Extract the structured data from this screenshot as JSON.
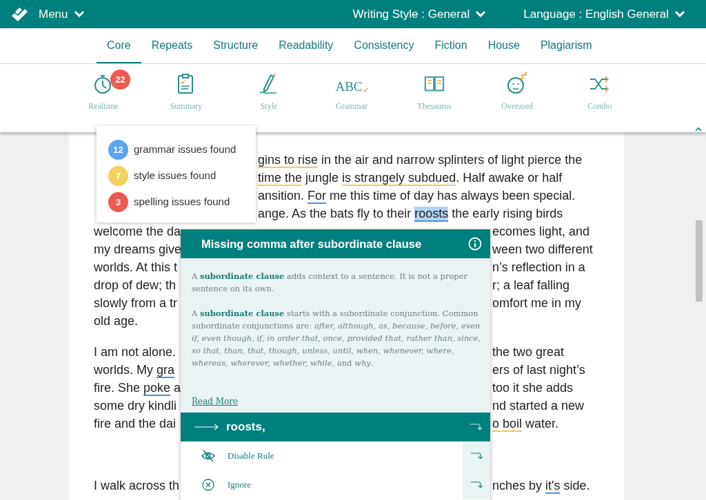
{
  "app_bar": {
    "menu_label": "Menu",
    "writing_style": "Writing Style : General",
    "language": "Language : English General"
  },
  "tabs": [
    {
      "label": "Core",
      "selected": true
    },
    {
      "label": "Repeats",
      "selected": false
    },
    {
      "label": "Structure",
      "selected": false
    },
    {
      "label": "Readability",
      "selected": false
    },
    {
      "label": "Consistency",
      "selected": false
    },
    {
      "label": "Fiction",
      "selected": false
    },
    {
      "label": "House",
      "selected": false
    },
    {
      "label": "Plagiarism",
      "selected": false
    }
  ],
  "tools": [
    {
      "label": "Realtime",
      "badge": "22"
    },
    {
      "label": "Summary"
    },
    {
      "label": "Style"
    },
    {
      "label": "Grammar",
      "icon_text": "ABC"
    },
    {
      "label": "Thesaurus"
    },
    {
      "label": "Overused"
    },
    {
      "label": "Combo"
    }
  ],
  "issue_summary": [
    {
      "count": "12",
      "label": "grammar issues found",
      "color": "#5aa4f0"
    },
    {
      "count": "7",
      "label": "style issues found",
      "color": "#f5cf5f"
    },
    {
      "count": "3",
      "label": "spelling issues found",
      "color": "#ef5a50"
    }
  ],
  "document": {
    "paragraphs": [
      {
        "lines": [
          {
            "after": [
              {
                "text": "gins to rise",
                "kind": "style"
              },
              {
                "text": " in the air and narrow splinters of light pierce the"
              }
            ]
          },
          {
            "after": [
              {
                "text": "time the",
                "kind": "style"
              },
              {
                "text": " jungle "
              },
              {
                "text": "is strangely subdued",
                "kind": "style"
              },
              {
                "text": ". Half awake or half"
              }
            ]
          },
          {
            "after": [
              {
                "text": "ansition. "
              },
              {
                "text": "For",
                "kind": "grammar"
              },
              {
                "text": " me this time of day has always been special."
              }
            ]
          },
          {
            "after": [
              {
                "text": "ange. As the bats fly to their "
              },
              {
                "text": "roosts",
                "kind": "selected"
              },
              {
                "text": " the early rising birds"
              }
            ]
          },
          {
            "before": [
              {
                "text": "welcome the da"
              }
            ],
            "after": [
              {
                "text": "ecomes light, and"
              }
            ]
          },
          {
            "before": [
              {
                "text": "my dreams give"
              }
            ],
            "after": [
              {
                "text": "ween two different"
              }
            ]
          },
          {
            "before": [
              {
                "text": "worlds. At this t"
              }
            ],
            "after": [
              {
                "text": "n’s reflection in a"
              }
            ]
          },
          {
            "before": [
              {
                "text": "drop of dew; th"
              }
            ],
            "after": [
              {
                "text": "r; a leaf falling"
              }
            ]
          },
          {
            "before": [
              {
                "text": "slowly from a tr"
              }
            ],
            "after": [
              {
                "text": "omfort me in my"
              }
            ]
          },
          {
            "before": [
              {
                "text": "old age."
              }
            ]
          }
        ]
      },
      {
        "lines": [
          {
            "before": [
              {
                "text": "I am not alone."
              }
            ],
            "after": [
              {
                "text": "the two great"
              }
            ]
          },
          {
            "before": [
              {
                "text": "worlds. My "
              },
              {
                "text": "gra",
                "kind": "grammar"
              }
            ],
            "after": [
              {
                "text": "ers of last night’s"
              }
            ]
          },
          {
            "before": [
              {
                "text": "fire. She "
              },
              {
                "text": "poke",
                "kind": "grammar"
              },
              {
                "text": " a"
              }
            ],
            "after": [
              {
                "text": "too it she adds"
              }
            ]
          },
          {
            "before": [
              {
                "text": "some dry kindli"
              }
            ],
            "after": [
              {
                "text": "nd started a new"
              }
            ]
          },
          {
            "before": [
              {
                "text": "fire and the dai"
              }
            ],
            "after": [
              {
                "text": "o boil",
                "kind": "style"
              },
              {
                "text": " water."
              }
            ]
          }
        ]
      },
      {
        "lines": [
          {
            "before": [
              {
                "text": "I walk across th"
              }
            ],
            "after": [
              {
                "text": "nches by "
              },
              {
                "text": "it's",
                "kind": "grammar"
              },
              {
                "text": " side."
              }
            ]
          }
        ]
      }
    ]
  },
  "issue_card": {
    "title": "Missing comma after subordinate clause",
    "paragraphs": [
      "A **subordinate clause** adds context to a sentence. It is not a proper sentence on its own.",
      "A **subordinate clause** starts with a subordinate conjunction. Common subordinate conjunctions are: *after, although, as, because, before, even if, even though, if, in order that, once, provided that, rather than, since, so that, than, that, though, unless, until, when, whenever, where, whereas, wherever, whether, while,* and *why*."
    ],
    "link": "Read More",
    "suggestion": "roosts,",
    "actions": [
      {
        "label": "Disable Rule"
      },
      {
        "label": "Ignore"
      }
    ]
  }
}
